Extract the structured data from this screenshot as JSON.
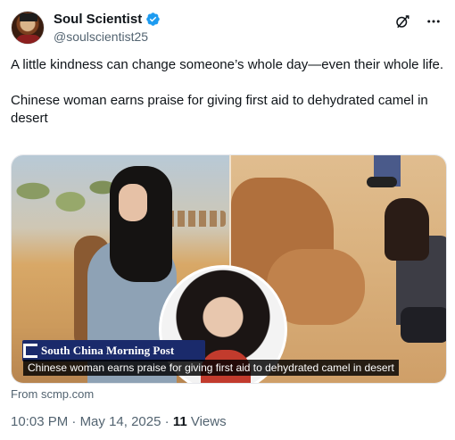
{
  "author": {
    "display_name": "Soul Scientist",
    "handle": "@soulscientist25",
    "verified_badge_color": "#1d9bf0"
  },
  "header_icons": [
    "grok-icon",
    "more-options-icon"
  ],
  "tweet": {
    "paragraph_1": "A little kindness can change someone’s whole day—even their whole life.",
    "paragraph_2": "Chinese woman earns praise for giving first aid to dehydrated camel in desert"
  },
  "media": {
    "publisher_logo_text": "South China Morning Post",
    "caption": "Chinese woman earns praise for giving first aid to dehydrated camel in desert"
  },
  "source": "From scmp.com",
  "meta": {
    "time": "10:03 PM",
    "separator_1": " · ",
    "date": "May 14, 2025",
    "separator_2": " · ",
    "views_count": "11",
    "views_label": " Views"
  }
}
